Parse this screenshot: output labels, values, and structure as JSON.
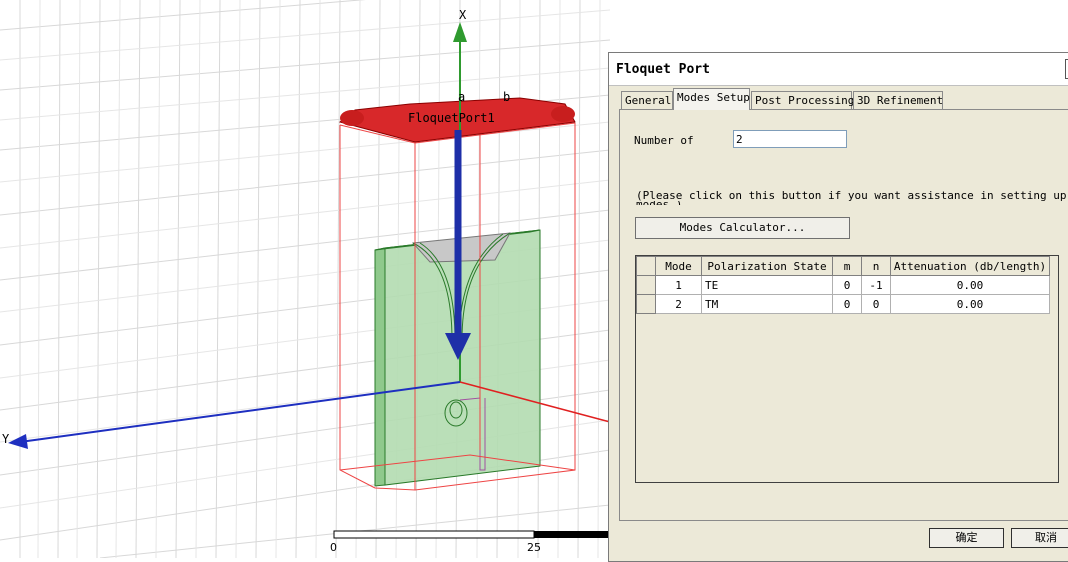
{
  "viewport": {
    "axis_x_label": "X",
    "axis_y_label": "Y",
    "port_name": "FloquetPort1",
    "lattice_a_label": "a",
    "lattice_b_label": "b",
    "ruler_start": "0",
    "ruler_mid": "25"
  },
  "dialog": {
    "title": "Floquet Port",
    "tabs": [
      {
        "label": "General",
        "active": false
      },
      {
        "label": "Modes Setup",
        "active": true
      },
      {
        "label": "Post Processing",
        "active": false
      },
      {
        "label": "3D Refinement",
        "active": false
      }
    ],
    "number_of_modes_label": "Number of",
    "number_of_modes_value": "2",
    "help_text_line1": "(Please click on this button if you want assistance in setting up",
    "help_text_line2": "modes.)",
    "modes_calculator_label": "Modes Calculator...",
    "table": {
      "columns": [
        "",
        "Mode",
        "Polarization State",
        "m",
        "n",
        "Attenuation (db/length)"
      ],
      "rows": [
        {
          "mode": "1",
          "polarization": "TE",
          "m": "0",
          "n": "-1",
          "attenuation": "0.00"
        },
        {
          "mode": "2",
          "polarization": "TM",
          "m": "0",
          "n": "0",
          "attenuation": "0.00"
        }
      ]
    },
    "ok_label": "确定",
    "cancel_label": "取消"
  },
  "colors": {
    "port_fill": "#d8282a",
    "substrate_fill": "#b3dcb0",
    "axis_x": "#2f9a2f",
    "axis_y": "#1e2fc0",
    "axis_z": "#e02020",
    "box_outline": "#ee4444"
  }
}
